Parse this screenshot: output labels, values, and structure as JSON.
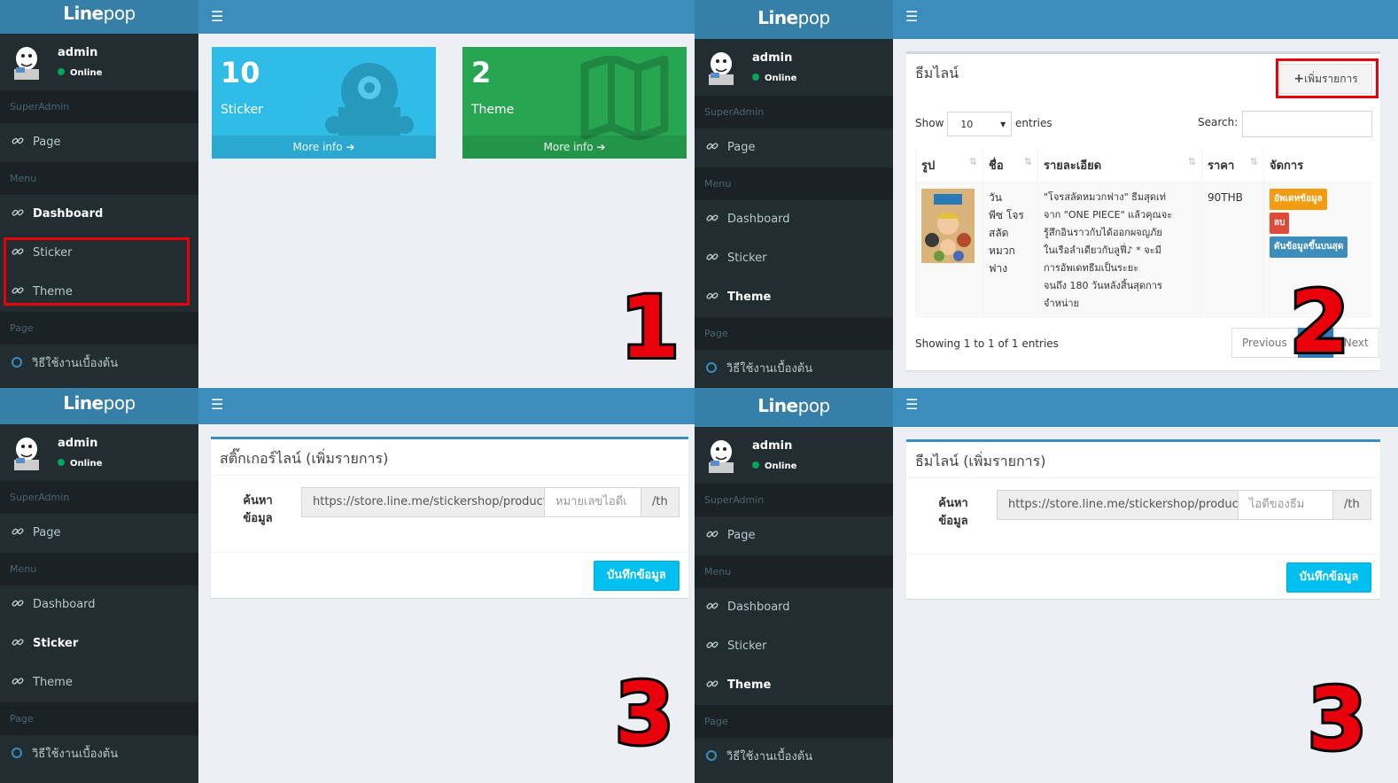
{
  "brand": {
    "bold": "Line",
    "rest": "pop"
  },
  "user": {
    "name": "admin",
    "status": "Online"
  },
  "sidebar": {
    "headers": [
      "SuperAdmin",
      "Menu",
      "Page"
    ],
    "items": [
      "Page",
      "Dashboard",
      "Sticker",
      "Theme",
      "วิธีใช้งานเบื้องต้น"
    ]
  },
  "colors": {
    "sidebar": "#222d32",
    "topbar": "#3c8dbc",
    "logo": "#367fa9",
    "aqua": "#00c0ef",
    "green": "#00a65a",
    "annotation": "#e8000b"
  },
  "step_numbers": [
    "1",
    "2",
    "3",
    "3"
  ],
  "dashboard": {
    "cards": [
      {
        "number": "10",
        "label": "Sticker",
        "more": "More info",
        "icon": "monster-icon",
        "color": "#2fbce8"
      },
      {
        "number": "2",
        "label": "Theme",
        "more": "More info",
        "icon": "map-icon",
        "color": "#27a652"
      }
    ]
  },
  "theme_list": {
    "title": "ธีมไลน์",
    "add_button": "เพิ่มรายการ",
    "show_label": "Show",
    "show_value": "10",
    "entries_label": "entries",
    "search_label": "Search:",
    "columns": [
      "รูป",
      "ชื่อ",
      "รายละเอียด",
      "ราคา",
      "จัดการ"
    ],
    "row": {
      "name_lines": [
        "วัน",
        "พีซ โจร",
        "สลัด",
        "หมวก",
        "ฟาง"
      ],
      "detail_lines": [
        "\"โจรสลัดหมวกฟาง\" ธีมสุดเท่",
        "จาก \"ONE PIECE\" แล้วคุณจะ",
        "รู้สึกอินราวกับได้ออกผจญภัย",
        "ในเรือลำเดียวกับลูฟี่♪ * จะมี",
        "การอัพเดทธีมเป็นระยะ",
        "จนถึง 180 วันหลังสิ้นสุดการ",
        "จำหน่าย"
      ],
      "price": "90THB",
      "actions": [
        "อัพเดทข้อมูล",
        "ลบ",
        "ดันข้อมูลขึ้นบนสุด"
      ]
    },
    "info": "Showing 1 to 1 of 1 entries",
    "prev": "Previous",
    "next": "Next"
  },
  "sticker_form": {
    "title": "สติ๊กเกอร์ไลน์ (เพิ่มรายการ)",
    "label_lines": [
      "ค้นหา",
      "ข้อมูล"
    ],
    "prefix": "https://store.line.me/stickershop/product/",
    "placeholder": "หมายเลขไอดีเ",
    "suffix": "/th",
    "save": "บันทึกข้อมูล"
  },
  "theme_form": {
    "title": "ธีมไลน์ (เพิ่มรายการ)",
    "label_lines": [
      "ค้นหา",
      "ข้อมูล"
    ],
    "prefix": "https://store.line.me/stickershop/product/",
    "placeholder": "ไอดีของธีม",
    "suffix": "/th",
    "save": "บันทึกข้อมูล"
  }
}
